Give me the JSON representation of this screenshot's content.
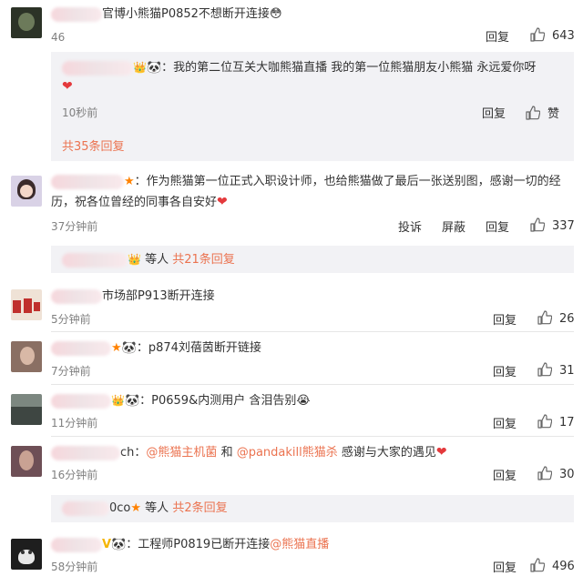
{
  "comments": [
    {
      "username_suffix": "",
      "text": "官博小熊猫P0852不想断开连接",
      "emoji": "😳",
      "time": "46",
      "reply_label": "回复",
      "likes": "643",
      "avatar_color": "#2c3327"
    },
    {
      "badges": "🐼",
      "text": "作为熊猫第一位正式入职设计师，也给熊猫做了最后一张送别图，感谢一切的经历，祝各位曾经的同事各自安好",
      "line1": "作为熊猫第一位正式入职设计师，也给熊猫做了最后一张送别图，感谢一切的经",
      "line2": "历，祝各位曾经的同事各自安好",
      "time": "37分钟前",
      "report_label": "投诉",
      "block_label": "屏蔽",
      "reply_label": "回复",
      "likes": "337",
      "avatar_color": "#d9d2e6"
    },
    {
      "text": "市场部P913断开连接",
      "time": "5分钟前",
      "reply_label": "回复",
      "likes": "26",
      "avatar_color": "#efe2d6"
    },
    {
      "text": "p874刘蓓茵断开链接",
      "time": "7分钟前",
      "reply_label": "回复",
      "likes": "31",
      "avatar_color": "#8a6f63"
    },
    {
      "text": "P0659&内测用户 含泪告别",
      "emoji": "😭",
      "time": "11分钟前",
      "reply_label": "回复",
      "likes": "17",
      "avatar_color": "#7c8780"
    },
    {
      "name_tail": "ch",
      "mention1": "@熊猫主机菌",
      "and": "和",
      "mention2": "@pandakill熊猫杀",
      "text": "感谢与大家的遇见",
      "time": "16分钟前",
      "reply_label": "回复",
      "likes": "30",
      "avatar_color": "#6e4f56"
    },
    {
      "text": "工程师P0819已断开连接",
      "mention": "@熊猫直播",
      "time": "58分钟前",
      "reply_label": "回复",
      "likes": "496",
      "avatar_color": "#1e1e1e"
    }
  ],
  "sub_reply": {
    "text": "我的第二位互关大咖熊猫直播 我的第一位熊猫朋友小熊猫 永远爱你呀",
    "time": "10秒前",
    "reply_label": "回复",
    "like_label": "赞",
    "total_label": "共35条回复"
  },
  "reply_summary_1": {
    "suffix": "等人",
    "total_label": "共21条回复"
  },
  "reply_summary_2": {
    "name_tail": "0co",
    "suffix": "等人",
    "total_label": "共2条回复"
  },
  "colors": {
    "link": "#eb7350",
    "star": "#ff8200",
    "reply_bg": "#f2f2f5"
  },
  "glyphs": {
    "star": "★",
    "panda": "🐼",
    "heart": "❤",
    "crown": "👑",
    "v": "V"
  }
}
